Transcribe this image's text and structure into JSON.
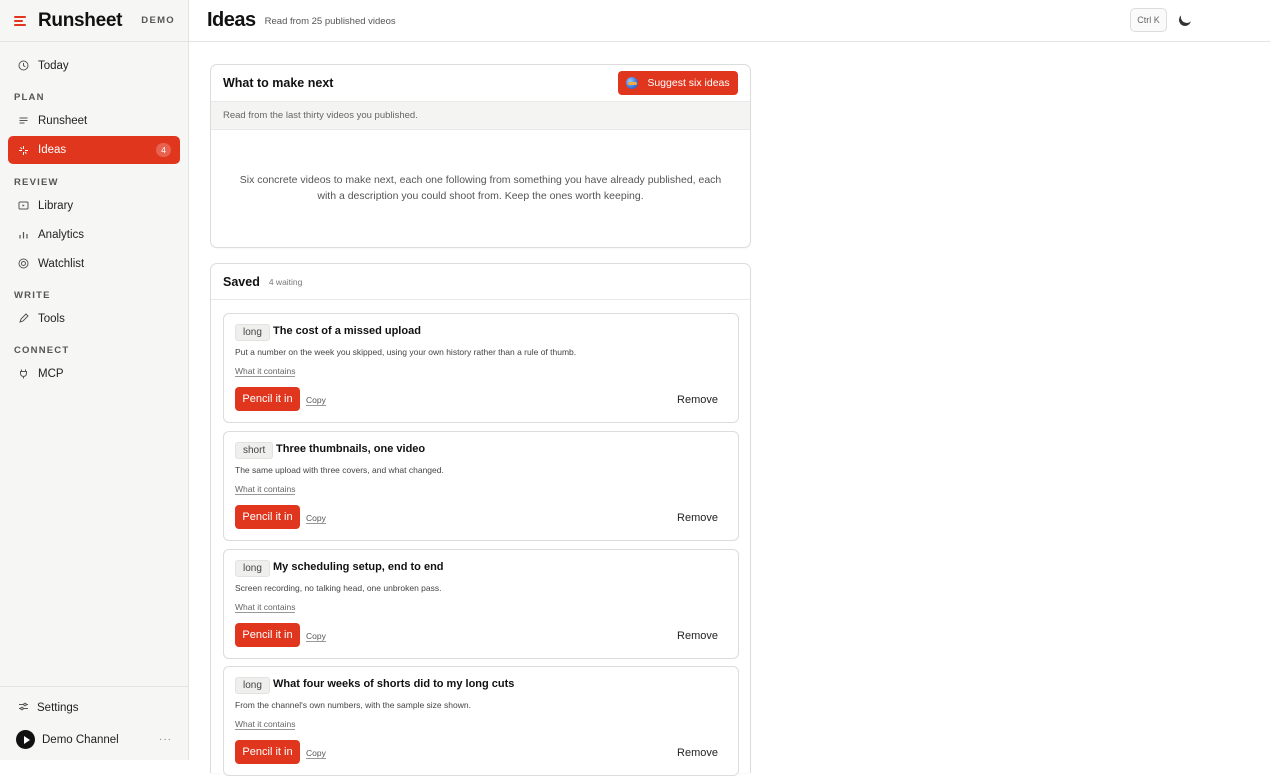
{
  "app": {
    "name": "Runsheet",
    "environment": "DEMO"
  },
  "sidebar": {
    "today": {
      "label": "Today",
      "icon": "clock-icon"
    },
    "sections": [
      {
        "label": "PLAN",
        "items": [
          {
            "label": "Runsheet",
            "icon": "lines-icon"
          },
          {
            "label": "Ideas",
            "icon": "sparkle-icon",
            "count": "4",
            "active": true
          }
        ]
      },
      {
        "label": "REVIEW",
        "items": [
          {
            "label": "Library",
            "icon": "library-icon"
          },
          {
            "label": "Analytics",
            "icon": "bar-chart-icon"
          },
          {
            "label": "Watchlist",
            "icon": "target-icon"
          }
        ]
      },
      {
        "label": "WRITE",
        "items": [
          {
            "label": "Tools",
            "icon": "pencil-icon"
          }
        ]
      },
      {
        "label": "CONNECT",
        "items": [
          {
            "label": "MCP",
            "icon": "plug-icon"
          }
        ]
      }
    ],
    "settings_label": "Settings",
    "channel_name": "Demo Channel",
    "channel_more": "···"
  },
  "header": {
    "title": "Ideas",
    "subtitle": "Read from 25 published videos",
    "shortcut": "Ctrl K"
  },
  "next_card": {
    "heading": "What to make next",
    "button_label": "Suggest six ideas",
    "subheading": "Read from the last thirty videos you published.",
    "description": "Six concrete videos to make next, each one following from something you have already published, each with a description you could shoot from. Keep the ones worth keeping."
  },
  "saved": {
    "heading": "Saved",
    "waiting": "4 waiting",
    "contains_label": "What it contains",
    "pencil_label": "Pencil it in",
    "copy_label": "Copy",
    "remove_label": "Remove",
    "ideas": [
      {
        "tag": "long",
        "title": "The cost of a missed upload",
        "description": "Put a number on the week you skipped, using your own history rather than a rule of thumb."
      },
      {
        "tag": "short",
        "title": "Three thumbnails, one video",
        "description": "The same upload with three covers, and what changed."
      },
      {
        "tag": "long",
        "title": "My scheduling setup, end to end",
        "description": "Screen recording, no talking head, one unbroken pass."
      },
      {
        "tag": "long",
        "title": "What four weeks of shorts did to my long cuts",
        "description": "From the channel's own numbers, with the sample size shown."
      }
    ]
  },
  "colors": {
    "accent": "#e0361e",
    "sidebar_bg": "#f6f6f5"
  }
}
